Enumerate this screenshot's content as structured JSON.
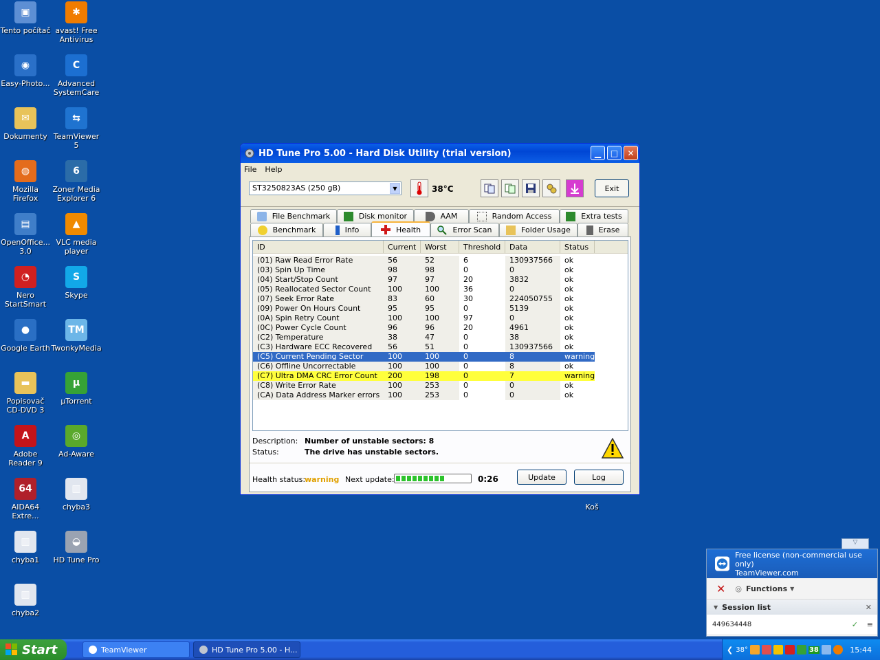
{
  "desktop": {
    "icons": [
      {
        "label": "Tento počítač",
        "color": "#5d8fd4",
        "glyph": "▣"
      },
      {
        "label": "avast! Free Antivirus",
        "color": "#f07c00",
        "glyph": "✱"
      },
      {
        "label": "Easy-Photo...",
        "color": "#2a70c8",
        "glyph": "◉"
      },
      {
        "label": "Advanced SystemCare",
        "color": "#1c6fd1",
        "glyph": "C"
      },
      {
        "label": "Dokumenty",
        "color": "#e8c35a",
        "glyph": "✉"
      },
      {
        "label": "TeamViewer 5",
        "color": "#1f73d0",
        "glyph": "⇆"
      },
      {
        "label": "Mozilla Firefox",
        "color": "#e46c1c",
        "glyph": "◍"
      },
      {
        "label": "Zoner Media Explorer 6",
        "color": "#2b6ca8",
        "glyph": "6"
      },
      {
        "label": "OpenOffice... 3.0",
        "color": "#3f7ec9",
        "glyph": "▤"
      },
      {
        "label": "VLC media player",
        "color": "#f08a00",
        "glyph": "▲"
      },
      {
        "label": "Nero StartSmart",
        "color": "#d02020",
        "glyph": "◔"
      },
      {
        "label": "Skype",
        "color": "#12a8e8",
        "glyph": "S"
      },
      {
        "label": "Google Earth",
        "color": "#2a6fc4",
        "glyph": "●"
      },
      {
        "label": "TwonkyMedia",
        "color": "#6cb6e8",
        "glyph": "TM"
      },
      {
        "label": "Popisovač CD-DVD 3",
        "color": "#e8c35a",
        "glyph": "▬"
      },
      {
        "label": "µTorrent",
        "color": "#36a236",
        "glyph": "µ"
      },
      {
        "label": "Adobe Reader 9",
        "color": "#c4141a",
        "glyph": "A"
      },
      {
        "label": "Ad-Aware",
        "color": "#5aa92b",
        "glyph": "◎"
      },
      {
        "label": "AIDA64 Extre...",
        "color": "#b0202a",
        "glyph": "64"
      },
      {
        "label": "chyba3",
        "color": "#e1e6ef",
        "glyph": "▥"
      },
      {
        "label": "chyba1",
        "color": "#e1e6ef",
        "glyph": "▥"
      },
      {
        "label": "HD Tune Pro",
        "color": "#9aa3b2",
        "glyph": "◒"
      },
      {
        "label": "chyba2",
        "color": "#e1e6ef",
        "glyph": "▥"
      }
    ],
    "recycle_label": "Koš"
  },
  "window": {
    "title": "HD Tune Pro 5.00 - Hard Disk Utility (trial version)",
    "menu": [
      "File",
      "Help"
    ],
    "drive": "ST3250823AS (250 gB)",
    "temperature": "38°C",
    "exit_label": "Exit",
    "tabs_top": [
      "File Benchmark",
      "Disk monitor",
      "AAM",
      "Random Access",
      "Extra tests"
    ],
    "tabs_bottom": [
      "Benchmark",
      "Info",
      "Health",
      "Error Scan",
      "Folder Usage",
      "Erase"
    ],
    "columns": [
      "ID",
      "Current",
      "Worst",
      "Threshold",
      "Data",
      "Status"
    ],
    "rows": [
      {
        "id": "(01) Raw Read Error Rate",
        "cur": "56",
        "worst": "52",
        "thr": "6",
        "data": "130937566",
        "status": "ok"
      },
      {
        "id": "(03) Spin Up Time",
        "cur": "98",
        "worst": "98",
        "thr": "0",
        "data": "0",
        "status": "ok"
      },
      {
        "id": "(04) Start/Stop Count",
        "cur": "97",
        "worst": "97",
        "thr": "20",
        "data": "3832",
        "status": "ok"
      },
      {
        "id": "(05) Reallocated Sector Count",
        "cur": "100",
        "worst": "100",
        "thr": "36",
        "data": "0",
        "status": "ok"
      },
      {
        "id": "(07) Seek Error Rate",
        "cur": "83",
        "worst": "60",
        "thr": "30",
        "data": "224050755",
        "status": "ok"
      },
      {
        "id": "(09) Power On Hours Count",
        "cur": "95",
        "worst": "95",
        "thr": "0",
        "data": "5139",
        "status": "ok"
      },
      {
        "id": "(0A) Spin Retry Count",
        "cur": "100",
        "worst": "100",
        "thr": "97",
        "data": "0",
        "status": "ok"
      },
      {
        "id": "(0C) Power Cycle Count",
        "cur": "96",
        "worst": "96",
        "thr": "20",
        "data": "4961",
        "status": "ok"
      },
      {
        "id": "(C2) Temperature",
        "cur": "38",
        "worst": "47",
        "thr": "0",
        "data": "38",
        "status": "ok"
      },
      {
        "id": "(C3) Hardware ECC Recovered",
        "cur": "56",
        "worst": "51",
        "thr": "0",
        "data": "130937566",
        "status": "ok"
      },
      {
        "id": "(C5) Current Pending Sector",
        "cur": "100",
        "worst": "100",
        "thr": "0",
        "data": "8",
        "status": "warning",
        "state": "sel"
      },
      {
        "id": "(C6) Offline Uncorrectable",
        "cur": "100",
        "worst": "100",
        "thr": "0",
        "data": "8",
        "status": "ok"
      },
      {
        "id": "(C7) Ultra DMA CRC Error Count",
        "cur": "200",
        "worst": "198",
        "thr": "0",
        "data": "7",
        "status": "warning",
        "state": "warn"
      },
      {
        "id": "(C8) Write Error Rate",
        "cur": "100",
        "worst": "253",
        "thr": "0",
        "data": "0",
        "status": "ok"
      },
      {
        "id": "(CA) Data Address Marker errors",
        "cur": "100",
        "worst": "253",
        "thr": "0",
        "data": "0",
        "status": "ok"
      }
    ],
    "description_label": "Description:",
    "description_value": "Number of unstable sectors: 8",
    "status_label": "Status:",
    "status_value": "The drive has unstable sectors.",
    "health_label": "Health status:",
    "health_value": "warning",
    "next_update_label": "Next update:",
    "next_update_progress": 0.7,
    "countdown": "0:26",
    "update_label": "Update",
    "log_label": "Log"
  },
  "teamviewer": {
    "header_line1": "Free license (non-commercial use only)",
    "header_line2": "TeamViewer.com",
    "functions_label": "Functions",
    "session_list_label": "Session list",
    "session_id": "449634448"
  },
  "taskbar": {
    "start_label": "Start",
    "tasks": [
      "TeamViewer",
      "HD Tune Pro 5.00 - H..."
    ],
    "tray_temp": "38°",
    "tray_num": "38",
    "clock": "15:44"
  }
}
